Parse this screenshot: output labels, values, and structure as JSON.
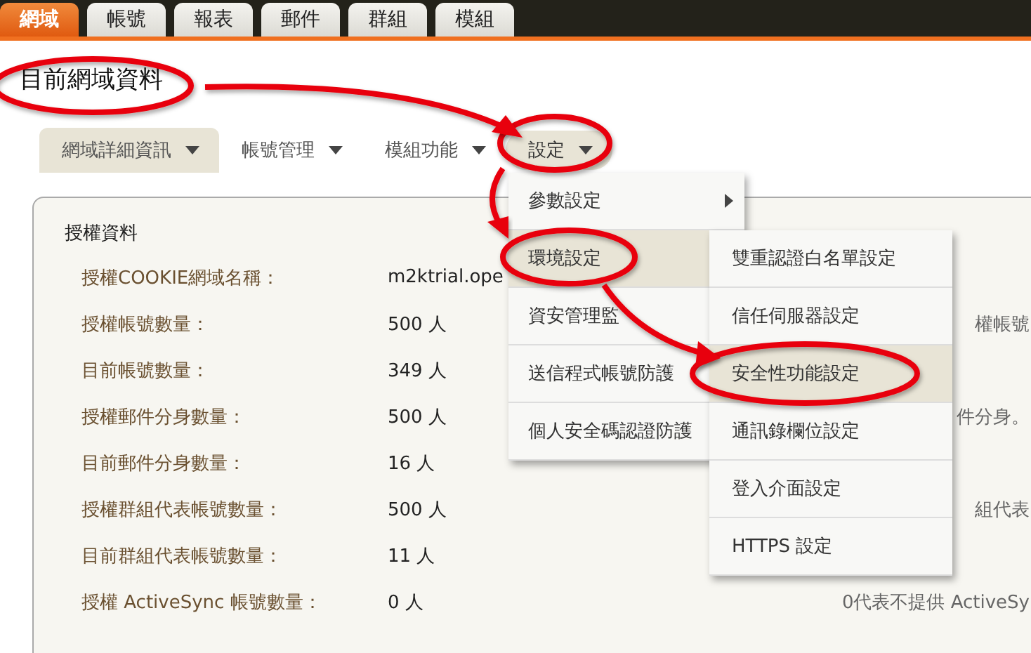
{
  "tabs": [
    {
      "label": "網域",
      "selected": true
    },
    {
      "label": "帳號",
      "selected": false
    },
    {
      "label": "報表",
      "selected": false
    },
    {
      "label": "郵件",
      "selected": false
    },
    {
      "label": "群組",
      "selected": false
    },
    {
      "label": "模組",
      "selected": false
    }
  ],
  "page_title": "目前網域資料",
  "subnav": [
    {
      "label": "網域詳細資訊",
      "selected": true,
      "open": false
    },
    {
      "label": "帳號管理",
      "selected": false,
      "open": false
    },
    {
      "label": "模組功能",
      "selected": false,
      "open": false
    },
    {
      "label": "設定",
      "selected": false,
      "open": true
    }
  ],
  "panel": {
    "title": "授權資料",
    "rows": [
      {
        "label": "授權COOKIE網域名稱：",
        "value": "m2ktrial.ope"
      },
      {
        "label": "授權帳號數量：",
        "value": "500 人",
        "note": "權帳號"
      },
      {
        "label": "目前帳號數量：",
        "value": "349 人"
      },
      {
        "label": "授權郵件分身數量：",
        "value": "500 人",
        "note": "件分身。"
      },
      {
        "label": "目前郵件分身數量：",
        "value": "16 人"
      },
      {
        "label": "授權群組代表帳號數量：",
        "value": "500 人",
        "note": "組代表"
      },
      {
        "label": "目前群組代表帳號數量：",
        "value": "11 人"
      },
      {
        "label": "授權 ActiveSync 帳號數量：",
        "value": "0 人",
        "note": "0代表不提供 ActiveSy"
      }
    ]
  },
  "menu": [
    {
      "label": "參數設定",
      "selected": false,
      "has_submenu": true
    },
    {
      "label": "環境設定",
      "selected": true
    },
    {
      "label": "資安管理監",
      "selected": false
    },
    {
      "label": "送信程式帳號防護",
      "selected": false
    },
    {
      "label": "個人安全碼認證防護",
      "selected": false
    }
  ],
  "submenu": [
    {
      "label": "雙重認證白名單設定",
      "selected": false
    },
    {
      "label": "信任伺服器設定",
      "selected": false
    },
    {
      "label": "安全性功能設定",
      "selected": true
    },
    {
      "label": "通訊錄欄位設定",
      "selected": false
    },
    {
      "label": "登入介面設定",
      "selected": false
    },
    {
      "label": "HTTPS 設定",
      "selected": false
    }
  ]
}
